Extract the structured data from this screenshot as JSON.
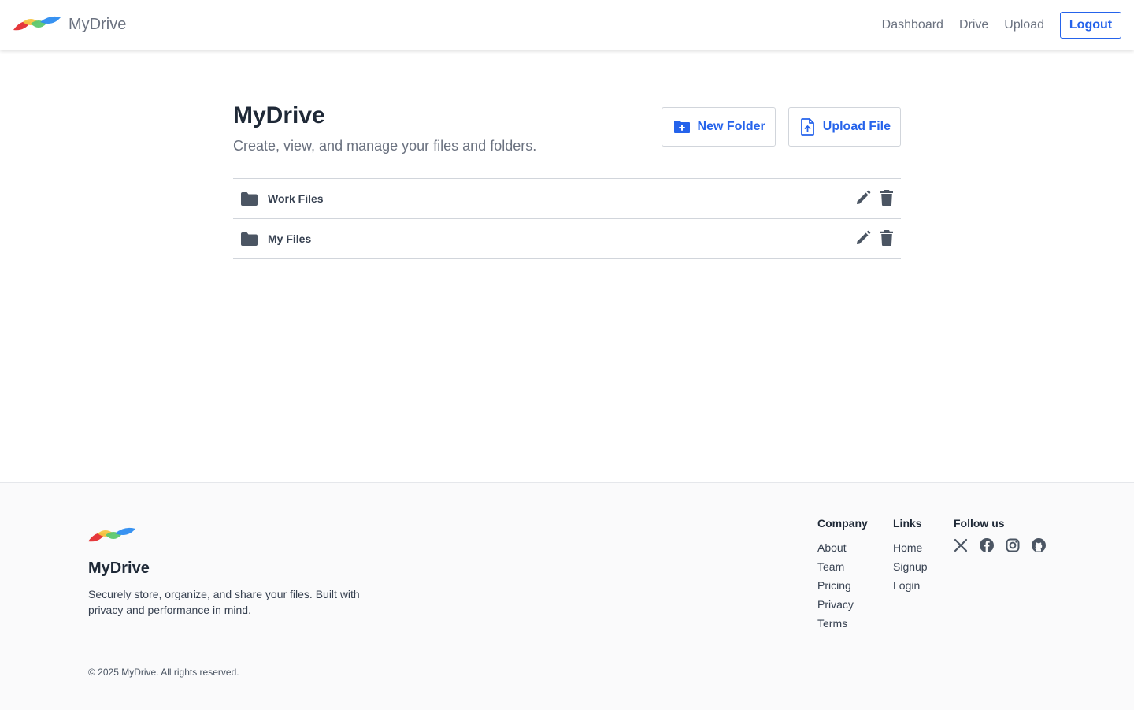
{
  "header": {
    "brand_name": "MyDrive",
    "nav": [
      "Dashboard",
      "Drive",
      "Upload"
    ],
    "logout_label": "Logout"
  },
  "main": {
    "title": "MyDrive",
    "subtitle": "Create, view, and manage your files and folders.",
    "new_folder_label": "New Folder",
    "upload_file_label": "Upload File",
    "folders": [
      "Work Files",
      "My Files"
    ]
  },
  "footer": {
    "brand_name": "MyDrive",
    "description": "Securely store, organize, and share your files. Built with privacy and performance in mind.",
    "company_title": "Company",
    "company_links": [
      "About",
      "Team",
      "Pricing",
      "Privacy",
      "Terms"
    ],
    "links_title": "Links",
    "links": [
      "Home",
      "Signup",
      "Login"
    ],
    "follow_title": "Follow us",
    "social_icons": [
      "x-icon",
      "facebook-icon",
      "instagram-icon",
      "github-icon"
    ],
    "copyright": "© 2025 MyDrive. All rights reserved."
  },
  "colors": {
    "accent": "#2563eb",
    "icon": "#4b5563",
    "logo_red": "#e5383b",
    "logo_yellow": "#f5c542",
    "logo_green": "#5cc86e",
    "logo_blue": "#2d8cf0"
  }
}
